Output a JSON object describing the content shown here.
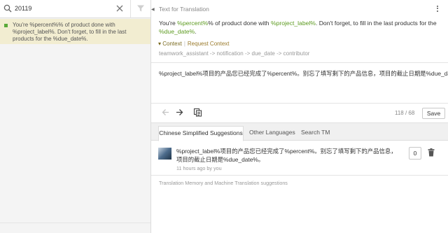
{
  "search": {
    "query": "20119"
  },
  "string_list": {
    "items": [
      {
        "text": "You're %percent%% of product done with %project_label%. Don't forget, to fill in the last products for the %due_date%.",
        "status_color": "#5aaa3a"
      }
    ]
  },
  "source": {
    "label": "Text for Translation",
    "segments": [
      {
        "text": "You're ",
        "ph": false
      },
      {
        "text": "%percent%",
        "ph": true
      },
      {
        "text": "% of product done with ",
        "ph": false
      },
      {
        "text": "%project_label%",
        "ph": true
      },
      {
        "text": ". Don't forget, to fill in the last products for the ",
        "ph": false
      },
      {
        "text": "%due_date%",
        "ph": true
      },
      {
        "text": ".",
        "ph": false
      }
    ],
    "context_label": "Context",
    "request_context_label": "Request Context",
    "context_path": "teamwork_assistant -> notification -> due_date -> contributor"
  },
  "editor": {
    "value": "%project_label%项目的产品您已经完成了%percent%。别忘了填写剩下的产品信息，项目的截止日期是%due_date%。",
    "char_count": "118 / 68",
    "save_label": "Save"
  },
  "tabs": [
    "Chinese Simplified Suggestions",
    "Other Languages",
    "Search TM"
  ],
  "suggestion": {
    "text": "%project_label%项目的产品您已经完成了%percent%。别忘了填写剩下的产品信息，项目的截止日期是%due_date%。",
    "meta": "11 hours ago by you",
    "votes": "0"
  },
  "tm_note": "Translation Memory and Machine Translation suggestions",
  "colors": {
    "placeholder": "#5c9a1f",
    "highlight_row": "#f2edd1"
  }
}
